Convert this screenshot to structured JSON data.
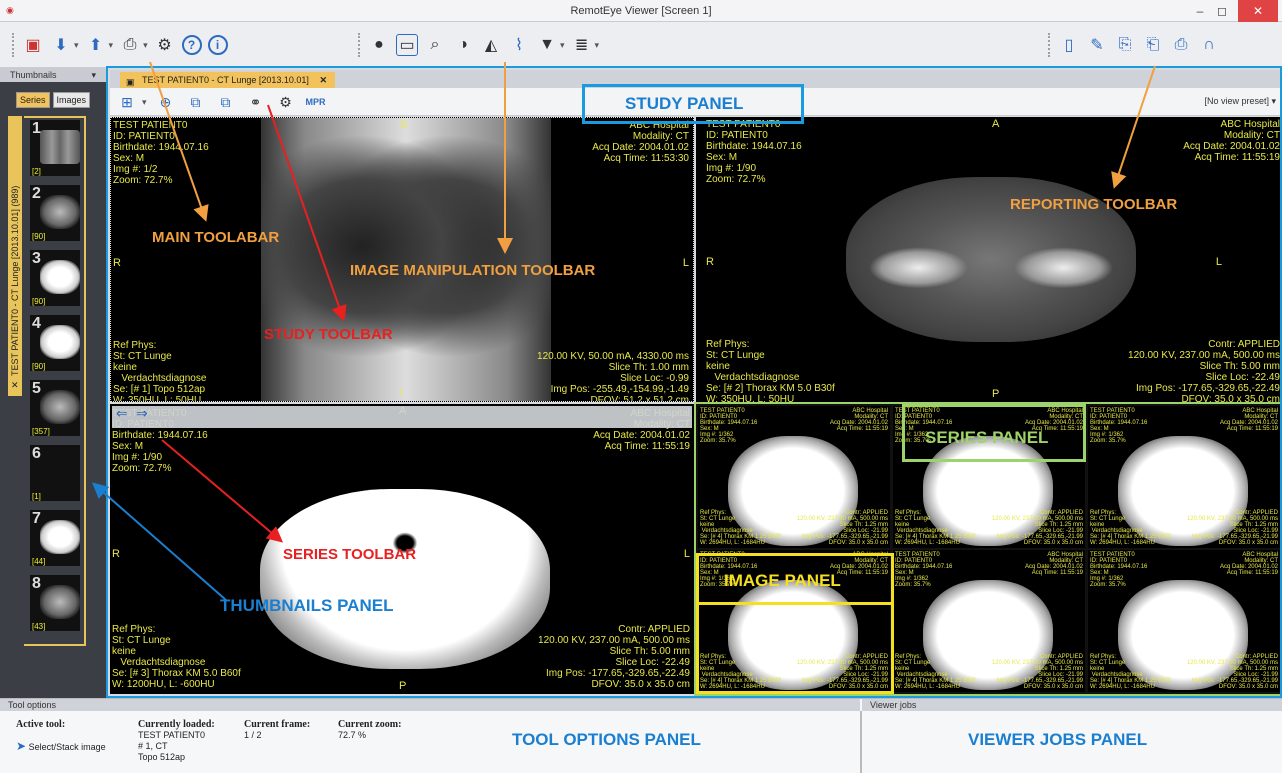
{
  "window": {
    "title": "RemotEye Viewer [Screen 1]",
    "min": "–",
    "max": "◻",
    "close": "✕"
  },
  "thumbnails": {
    "header": "Thumbnails",
    "tabs": [
      "Series",
      "Images"
    ],
    "study_tab": "TEST PATIENT0 - CT Lunge [2013.10.01] (989)",
    "close": "✕",
    "items": [
      {
        "num": "1",
        "count": "[2]"
      },
      {
        "num": "2",
        "count": "[90]"
      },
      {
        "num": "3",
        "count": "[90]"
      },
      {
        "num": "4",
        "count": "[90]"
      },
      {
        "num": "5",
        "count": "[357]"
      },
      {
        "num": "6",
        "count": "[1]"
      },
      {
        "num": "7",
        "count": "[44]"
      },
      {
        "num": "8",
        "count": "[43]"
      }
    ]
  },
  "study": {
    "tab_label": "TEST PATIENT0 - CT Lunge [2013.10.01]",
    "tab_close": "✕",
    "preset": "[No view preset]",
    "mpr_label": "MPR"
  },
  "viewports": {
    "v1": {
      "tl": "TEST PATIENT0\nID: PATIENT0\nBirthdate: 1944.07.16\nSex: M\nImg #: 1/2\nZoom: 72.7%",
      "tr": "ABC Hospital\nModality: CT\nAcq Date: 2004.01.02\nAcq Time: 11:53:30",
      "bl": "Ref Phys:\nSt: CT Lunge\nkeine\n   Verdachtsdiagnose\nSe: [# 1] Topo 512ap\nW: 350HU, L: 50HU",
      "br": "120.00 KV, 50.00 mA, 4330.00 ms\nSlice Th: 1.00 mm\nSlice Loc: -0.99\nImg Pos: -255.49,-154.99,-1.49\nDFOV: 51.2 x 51.2 cm",
      "top": "S",
      "left": "R",
      "right": "L",
      "bottom": "I"
    },
    "v2": {
      "tl": "TEST PATIENT0\nID: PATIENT0\nBirthdate: 1944.07.16\nSex: M\nImg #: 1/90\nZoom: 72.7%",
      "tr": "ABC Hospital\nModality: CT\nAcq Date: 2004.01.02\nAcq Time: 11:55:19",
      "bl": "Ref Phys:\nSt: CT Lunge\nkeine\n   Verdachtsdiagnose\nSe: [# 2] Thorax KM 5.0 B30f\nW: 350HU, L: 50HU",
      "br": "Contr: APPLIED\n120.00 KV, 237.00 mA, 500.00 ms\nSlice Th: 5.00 mm\nSlice Loc: -22.49\nImg Pos: -177.65,-329.65,-22.49\nDFOV: 35.0 x 35.0 cm",
      "top": "A",
      "left": "R",
      "right": "L",
      "bottom": "P"
    },
    "v3": {
      "tl": "TEST PATIENT0\nID: PATIENT0\nBirthdate: 1944.07.16\nSex: M\nImg #: 1/90\nZoom: 72.7%",
      "tr": "ABC Hospital\nModality: CT\nAcq Date: 2004.01.02\nAcq Time: 11:55:19",
      "bl": "Ref Phys:\nSt: CT Lunge\nkeine\n   Verdachtsdiagnose\nSe: [# 3] Thorax KM 5.0 B60f\nW: 1200HU, L: -600HU",
      "br": "Contr: APPLIED\n120.00 KV, 237.00 mA, 500.00 ms\nSlice Th: 5.00 mm\nSlice Loc: -22.49\nImg Pos: -177.65,-329.65,-22.49\nDFOV: 35.0 x 35.0 cm",
      "top": "A",
      "left": "R",
      "right": "L",
      "bottom": "P"
    },
    "mini": {
      "tl": "TEST PATIENT0\nID: PATIENT0\nBirthdate: 1944.07.16\nSex: M\nImg #: 1/362\nZoom: 35.7%",
      "tr": "ABC Hospital\nModality: CT\nAcq Date: 2004.01.02\nAcq Time: 11:55:19",
      "bl": "Ref Phys:\nSt: CT Lunge\nkeine\n Verdachtsdiagnose\nSe: [# 4] Thorax KM 1.25 B60f\nW: 2694HU, L: -1684HU",
      "br": "Contr: APPLIED\n120.00 KV, 237.00 mA, 500.00 ms\nSlice Th: 1.25 mm\nSlice Loc: -21.99\nImg Pos: -177.65,-329.65,-21.99\nDFOV: 35.0 x 35.0 cm",
      "top": "A",
      "left": "R",
      "right": "L"
    }
  },
  "tool_options": {
    "header": "Tool options",
    "active_tool_label": "Active tool:",
    "active_tool_value": "Select/Stack image",
    "loaded_label": "Currently loaded:",
    "loaded_value": "TEST PATIENT0\n# 1, CT\nTopo 512ap",
    "frame_label": "Current frame:",
    "frame_value": "1 / 2",
    "zoom_label": "Current zoom:",
    "zoom_value": "72.7 %"
  },
  "viewer_jobs": {
    "header": "Viewer jobs"
  },
  "annotations": {
    "study_panel": "STUDY PANEL",
    "main_toolbar": "MAIN TOOLABAR",
    "image_manipulation": "IMAGE MANIPULATION TOOLBAR",
    "study_toolbar": "STUDY TOOLBAR",
    "reporting_toolbar": "REPORTING TOOLBAR",
    "series_panel": "SERIES PANEL",
    "series_toolbar": "SERIES TOOLBAR",
    "image_panel": "IMAGE PANEL",
    "thumbnails_panel": "THUMBNAILS PANEL",
    "tool_options_panel": "TOOL OPTIONS PANEL",
    "viewer_jobs_panel": "VIEWER JOBS PANEL"
  },
  "colors": {
    "accent": "#f2c35c",
    "annot_orange": "#f0a040",
    "annot_red": "#e82020",
    "annot_blue": "#1a7fd0",
    "annot_green": "#9dd36a",
    "annot_yellow": "#f5e020",
    "overlay_text": "#e8e84a"
  }
}
